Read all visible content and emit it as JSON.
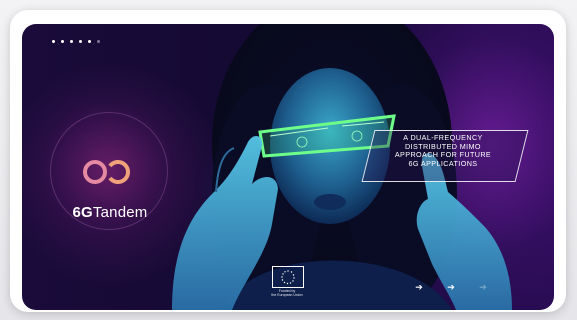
{
  "slide": {
    "progress_dots": [
      true,
      true,
      true,
      true,
      true,
      false
    ],
    "logo": {
      "name_bold": "6G",
      "name_regular": "Tandem",
      "icon": "infinity-loop-icon",
      "accent_color": "#e88a8a"
    },
    "callout": {
      "lines": [
        "A DUAL-FREQUENCY",
        "DISTRIBUTED MIMO",
        "APPROACH FOR FUTURE",
        "6G APPLICATIONS"
      ]
    },
    "funding": {
      "caption_lines": [
        "Funded by",
        "the European Union"
      ],
      "icon": "eu-flag-icon"
    },
    "nav": [
      {
        "icon": "arrow-right-icon",
        "active": true
      },
      {
        "icon": "arrow-right-icon",
        "active": true
      },
      {
        "icon": "arrow-right-icon",
        "active": false
      }
    ]
  }
}
